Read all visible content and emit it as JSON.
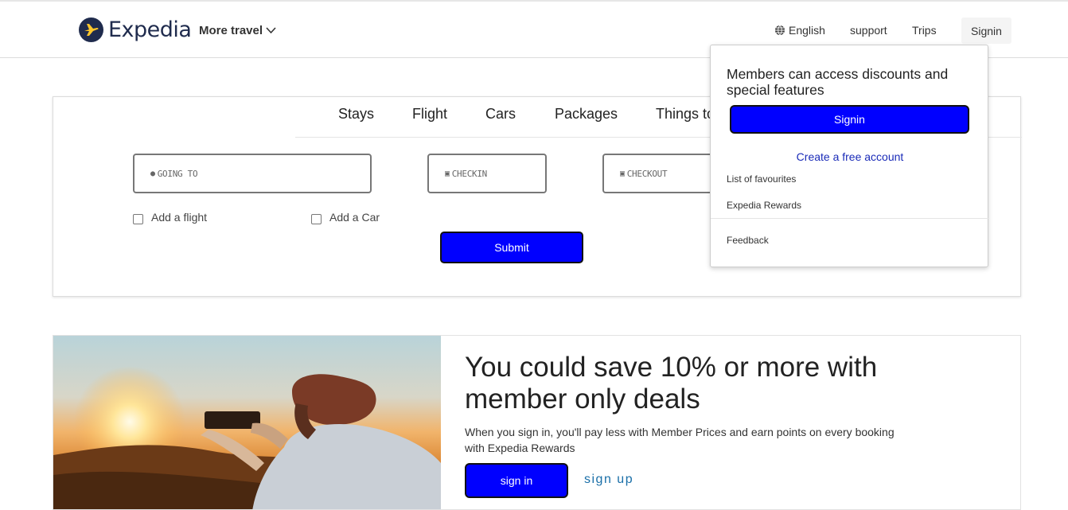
{
  "header": {
    "brand": "Expedia",
    "more_travel": "More travel",
    "language": "English",
    "support": "support",
    "trips": "Trips",
    "signin": "Signin"
  },
  "search": {
    "tabs": [
      "Stays",
      "Flight",
      "Cars",
      "Packages",
      "Things to do"
    ],
    "going_to": "GOING TO",
    "checkin": "CHECKIN",
    "checkout": "CHECKOUT",
    "add_flight": "Add a flight",
    "add_car": "Add a Car",
    "submit": "Submit"
  },
  "dropdown": {
    "title": "Members can access discounts and special features",
    "signin": "Signin",
    "create_account": "Create a free account",
    "favourites": "List of favourites",
    "rewards": "Expedia Rewards",
    "feedback": "Feedback"
  },
  "promo": {
    "title": "You could save 10% or more with member only deals",
    "subtitle": "When you sign in, you'll pay less with Member Prices and earn points on every booking with Expedia Rewards",
    "signin": "sign in",
    "signup": "sign up"
  },
  "colors": {
    "brand_navy": "#1f2b4d",
    "button_blue": "#0000ff",
    "link_blue": "#1a2bb8"
  }
}
